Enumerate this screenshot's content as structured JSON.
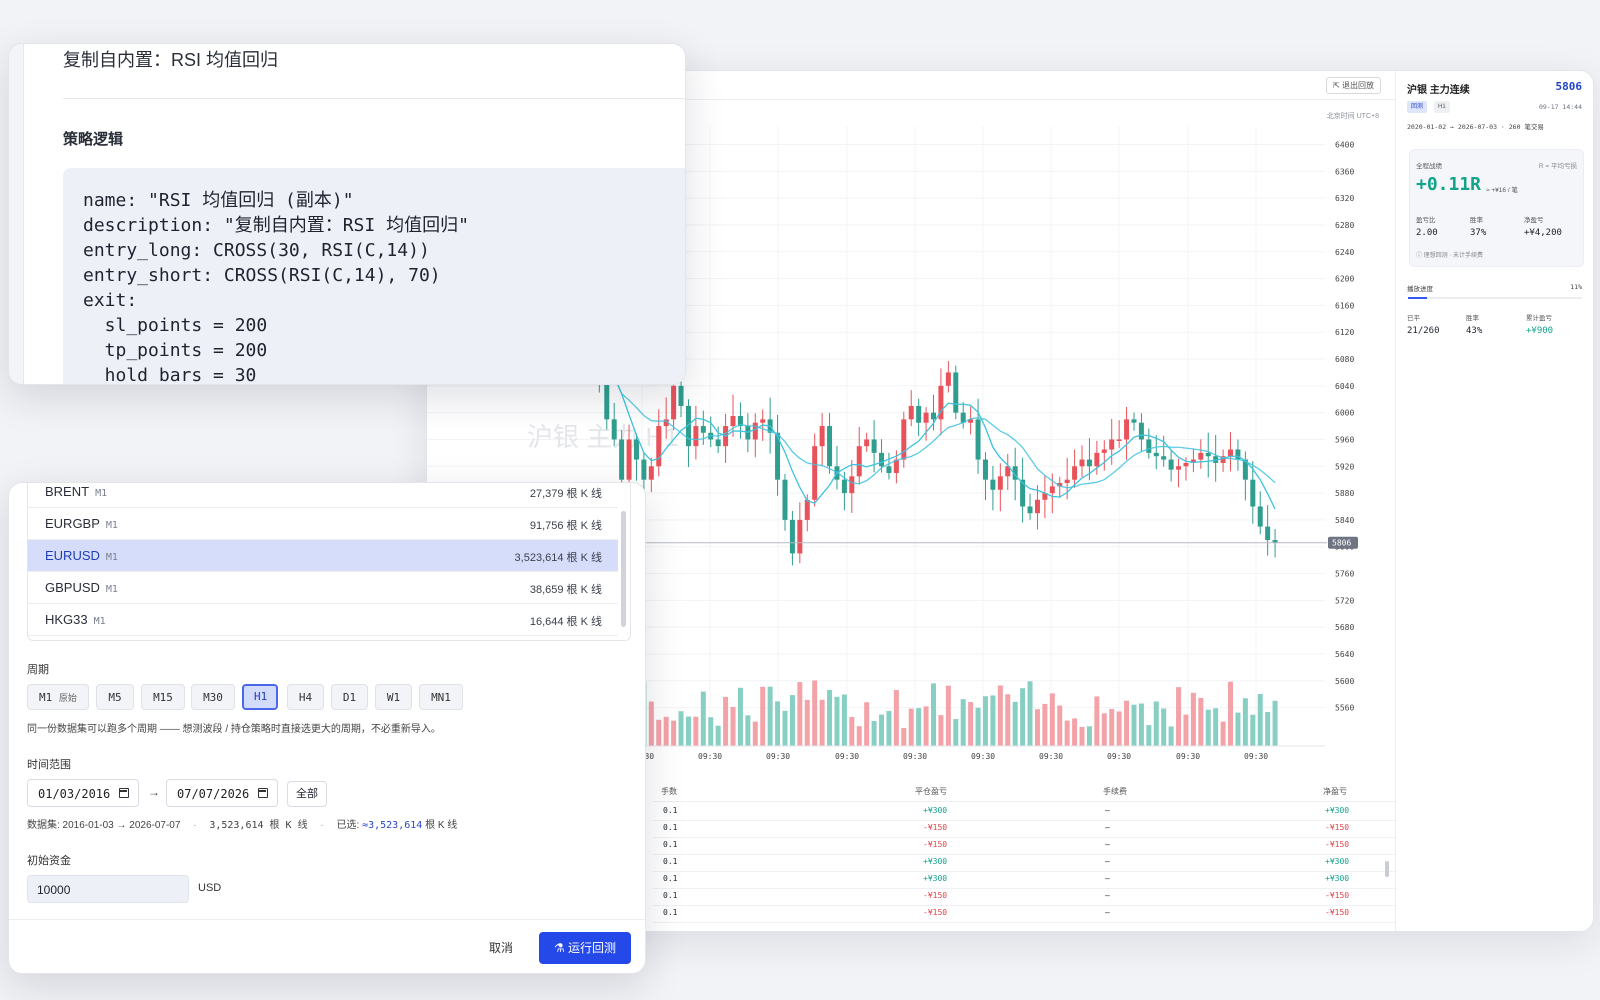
{
  "chart_window": {
    "exit_replay_label": "⇱ 退出回放",
    "timezone": "北京时间 UTC+8",
    "watermark": "沪银 主力 H1",
    "price_labels": [
      "6440",
      "6400",
      "6360",
      "6320",
      "6280",
      "6240",
      "6200",
      "6160",
      "6120",
      "6080",
      "6040",
      "6000",
      "5960",
      "5920",
      "5880",
      "5840",
      "5800",
      "5760",
      "5720",
      "5680",
      "5640",
      "5600",
      "5560"
    ],
    "current_price_tag": "5806",
    "time_labels": [
      "09:30",
      "09:30",
      "09:30",
      "09:30",
      "09:30",
      "09:30",
      "09:30",
      "09:30",
      "09:30",
      "09:30"
    ],
    "colors": {
      "up": "#e8535b",
      "down": "#2f9e8f",
      "ma": "#3ec3de",
      "vol_up": "#f3a3a7",
      "vol_down": "#88cfc3"
    }
  },
  "chart_data": {
    "type": "candlestick",
    "title": "沪银 主力 H1",
    "ylim": [
      5540,
      6450
    ],
    "price_ticks": [
      6440,
      6400,
      6360,
      6320,
      6280,
      6240,
      6200,
      6160,
      6120,
      6080,
      6040,
      6000,
      5960,
      5920,
      5880,
      5840,
      5800,
      5760,
      5720,
      5680,
      5640,
      5600,
      5560
    ],
    "last_price": 5806
  },
  "trades_table": {
    "headers": {
      "lots": "手数",
      "close_pnl": "平仓盈亏",
      "fee": "手续费",
      "net_pnl": "净盈亏"
    },
    "rows": [
      {
        "lots": "0.1",
        "close_pnl": "+¥300",
        "fee": "—",
        "net_pnl": "+¥300",
        "dir": "pos"
      },
      {
        "lots": "0.1",
        "close_pnl": "-¥150",
        "fee": "—",
        "net_pnl": "-¥150",
        "dir": "neg"
      },
      {
        "lots": "0.1",
        "close_pnl": "-¥150",
        "fee": "—",
        "net_pnl": "-¥150",
        "dir": "neg"
      },
      {
        "lots": "0.1",
        "close_pnl": "+¥300",
        "fee": "—",
        "net_pnl": "+¥300",
        "dir": "pos"
      },
      {
        "lots": "0.1",
        "close_pnl": "+¥300",
        "fee": "—",
        "net_pnl": "+¥300",
        "dir": "pos"
      },
      {
        "lots": "0.1",
        "close_pnl": "-¥150",
        "fee": "—",
        "net_pnl": "-¥150",
        "dir": "neg"
      },
      {
        "lots": "0.1",
        "close_pnl": "-¥150",
        "fee": "—",
        "net_pnl": "-¥150",
        "dir": "neg"
      }
    ]
  },
  "side_panel": {
    "symbol": "沪银 主力连续",
    "price": "5806",
    "tag_replay": "回测",
    "tag_period": "H1",
    "datetime": "09-17 14:44",
    "range": "2020-01-02 → 2026-07-03 · 260 笔交易",
    "stats": {
      "title": "全程战绩",
      "r_note": "R = 平均亏损",
      "total_r": "+0.11R",
      "per_trade": "≈ +¥16 / 笔",
      "pl_ratio_label": "盈亏比",
      "pl_ratio": "2.00",
      "win_rate_label": "胜率",
      "win_rate": "37%",
      "net_label": "净盈亏",
      "net": "+¥4,200",
      "note": "ⓘ 理想回测 · 未计手续费"
    },
    "progress": {
      "label": "播放进度",
      "percent_text": "11%",
      "value": 0.11,
      "closed_label": "已平",
      "closed": "21/260",
      "win_label": "胜率",
      "win": "43%",
      "cum_label": "累计盈亏",
      "cum": "+¥900"
    }
  },
  "code_dialog": {
    "title": "复制自内置：RSI 均值回归",
    "logic_label": "策略逻辑",
    "code": "name: \"RSI 均值回归 (副本)\"\ndescription: \"复制自内置：RSI 均值回归\"\nentry_long: CROSS(30, RSI(C,14))\nentry_short: CROSS(RSI(C,14), 70)\nexit:\n  sl_points = 200\n  tp_points = 200\n  hold_bars = 30"
  },
  "setup_dialog": {
    "datasets": [
      {
        "name": "BRENT",
        "tf": "M1",
        "count": "27,379 根 K 线",
        "selected": false
      },
      {
        "name": "EURGBP",
        "tf": "M1",
        "count": "91,756 根 K 线",
        "selected": false
      },
      {
        "name": "EURUSD",
        "tf": "M1",
        "count": "3,523,614 根 K 线",
        "selected": true
      },
      {
        "name": "GBPUSD",
        "tf": "M1",
        "count": "38,659 根 K 线",
        "selected": false
      },
      {
        "name": "HKG33",
        "tf": "M1",
        "count": "16,644 根 K 线",
        "selected": false
      }
    ],
    "period_label": "周期",
    "periods": [
      "M1",
      "M5",
      "M15",
      "M30",
      "H1",
      "H4",
      "D1",
      "W1",
      "MN1"
    ],
    "period_original": "原始",
    "period_active": "H1",
    "period_hint": "同一份数据集可以跑多个周期 —— 想测波段 / 持仓策略时直接选更大的周期，不必重新导入。",
    "range_label": "时间范围",
    "start_date": "01/03/2016",
    "arrow": "→",
    "end_date": "07/07/2026",
    "all_label": "全部",
    "dataset_info": "数据集: 2016-01-03 → 2026-07-07",
    "dataset_bars": "3,523,614 根 K 线",
    "selected_prefix": "已选:",
    "selected_bars": "≈3,523,614",
    "selected_suffix": "根 K 线",
    "capital_label": "初始资金",
    "capital_value": "10000",
    "capital_unit": "USD",
    "cancel_label": "取消",
    "run_label": "运行回测"
  }
}
